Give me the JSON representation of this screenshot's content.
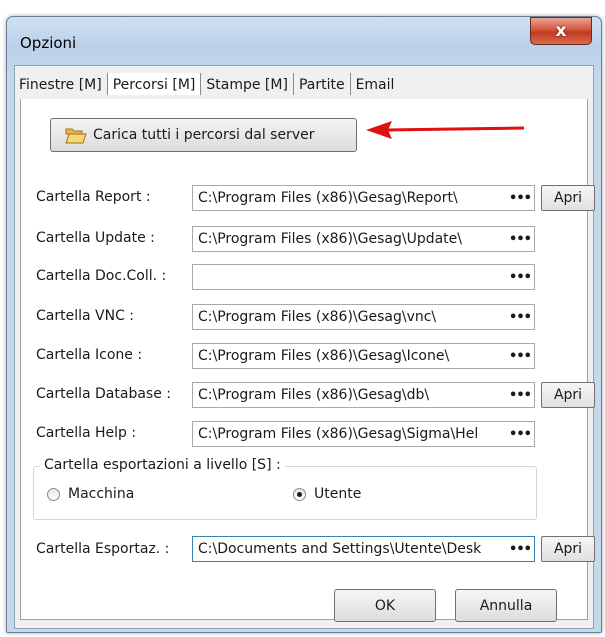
{
  "window": {
    "title": "Opzioni",
    "close_label": "x"
  },
  "tabs": [
    {
      "label": "Finestre [M]"
    },
    {
      "label": "Percorsi [M]"
    },
    {
      "label": "Stampe [M]"
    },
    {
      "label": "Partite"
    },
    {
      "label": "Email"
    }
  ],
  "active_tab": "Percorsi [M]",
  "load_button": {
    "label": "Carica tutti i percorsi dal server",
    "icon": "open-folder-icon"
  },
  "annotation": {
    "color": "#e01010",
    "icon": "red-arrow-icon"
  },
  "browse_label": "•••",
  "open_label": "Apri",
  "paths": [
    {
      "label": "Cartella Report :",
      "value": "C:\\Program Files (x86)\\Gesag\\Report\\",
      "has_open": true
    },
    {
      "label": "Cartella Update :",
      "value": "C:\\Program Files (x86)\\Gesag\\Update\\",
      "has_open": false
    },
    {
      "label": "Cartella Doc.Coll. :",
      "value": "",
      "has_open": false
    },
    {
      "label": "Cartella VNC :",
      "value": "C:\\Program Files (x86)\\Gesag\\vnc\\",
      "has_open": false
    },
    {
      "label": "Cartella Icone :",
      "value": "C:\\Program Files (x86)\\Gesag\\Icone\\",
      "has_open": false
    },
    {
      "label": "Cartella Database :",
      "value": "C:\\Program Files (x86)\\Gesag\\db\\",
      "has_open": true
    },
    {
      "label": "Cartella Help :",
      "value": "C:\\Program Files (x86)\\Gesag\\Sigma\\Hel",
      "has_open": false
    }
  ],
  "export_group": {
    "title": "Cartella esportazioni a livello [S] :",
    "options": [
      {
        "label": "Macchina",
        "checked": false
      },
      {
        "label": "Utente",
        "checked": true
      }
    ]
  },
  "export_path": {
    "label": "Cartella Esportaz. :",
    "value": "C:\\Documents and Settings\\Utente\\Desk",
    "has_open": true
  },
  "buttons": {
    "ok": "OK",
    "cancel": "Annulla"
  }
}
